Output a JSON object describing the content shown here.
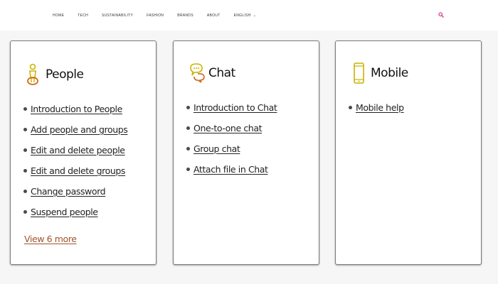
{
  "colors": {
    "accent": "#d6257a",
    "icon_gold": "#c9b400",
    "icon_orange": "#d2691e",
    "view_more": "#a0522d"
  },
  "nav": {
    "items": [
      {
        "label": "HOME"
      },
      {
        "label": "TECH"
      },
      {
        "label": "SUSTAINABILITY"
      },
      {
        "label": "FASHION"
      },
      {
        "label": "BRANDS"
      },
      {
        "label": "ABOUT"
      },
      {
        "label": "ENGLISH"
      }
    ],
    "search_icon": "search-icon"
  },
  "cards": {
    "people": {
      "icon": "person-icon",
      "title": "People",
      "links": [
        "Introduction to People",
        "Add people and groups",
        "Edit and delete people",
        "Edit and delete groups",
        "Change password",
        "Suspend people"
      ],
      "view_more": "View 6 more"
    },
    "chat": {
      "icon": "chat-bubble-icon",
      "title": "Chat",
      "links": [
        "Introduction to Chat",
        "One-to-one chat",
        "Group chat",
        "Attach file in Chat"
      ]
    },
    "mobile": {
      "icon": "mobile-phone-icon",
      "title": "Mobile",
      "links": [
        "Mobile help"
      ]
    }
  }
}
